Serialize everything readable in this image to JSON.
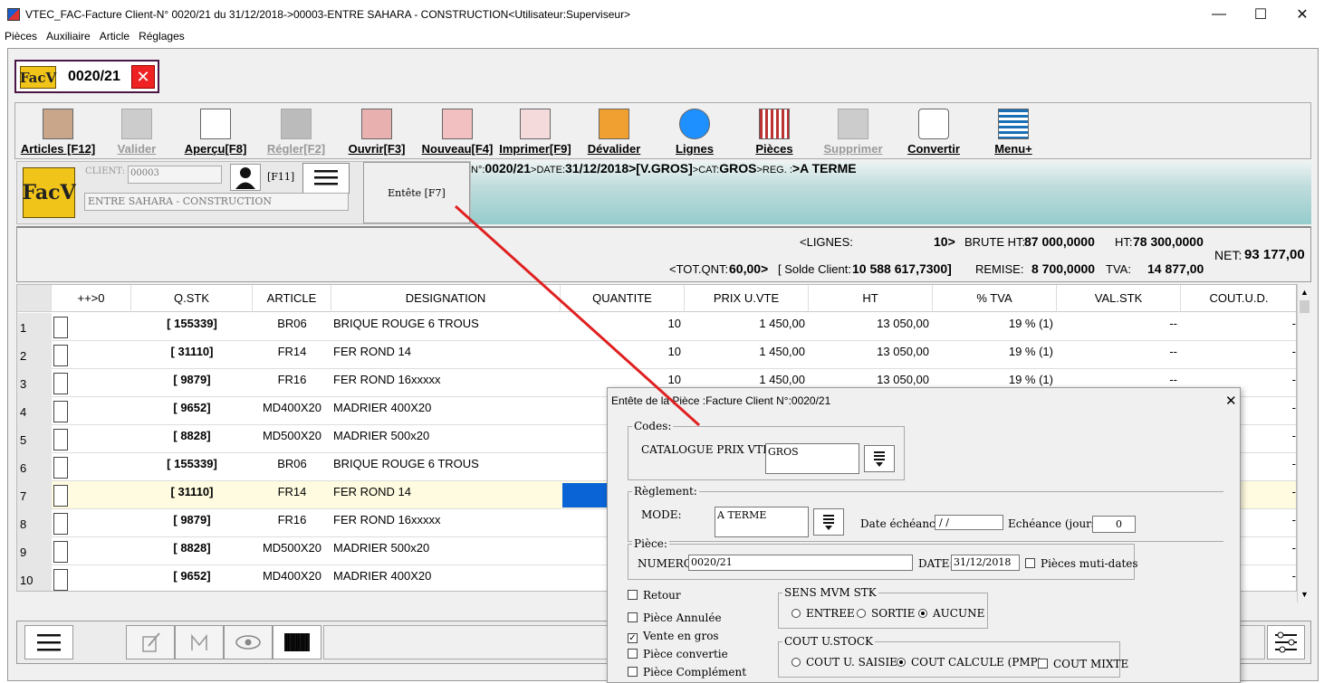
{
  "window": {
    "title": "VTEC_FAC-Facture Client-N° 0020/21 du 31/12/2018->00003-ENTRE SAHARA - CONSTRUCTION<Utilisateur:Superviseur>"
  },
  "menu": [
    "Pièces",
    "Auxiliaire",
    "Article",
    "Réglages"
  ],
  "doc_tab": {
    "badge": "FacV",
    "number": "0020/21"
  },
  "toolbar": [
    {
      "label": "Articles [F12]",
      "enabled": true,
      "icon": "articles-icon"
    },
    {
      "label": "Valider",
      "enabled": false,
      "icon": "validate-icon"
    },
    {
      "label": "Aperçu[F8]",
      "enabled": true,
      "icon": "preview-icon"
    },
    {
      "label": "Régler[F2]",
      "enabled": false,
      "icon": "payment-icon"
    },
    {
      "label": "Ouvrir[F3]",
      "enabled": true,
      "icon": "open-icon"
    },
    {
      "label": "Nouveau[F4]",
      "enabled": true,
      "icon": "new-icon"
    },
    {
      "label": "Imprimer[F9]",
      "enabled": true,
      "icon": "printer-icon"
    },
    {
      "label": "Dévalider",
      "enabled": true,
      "icon": "unvalidate-icon"
    },
    {
      "label": "Lignes",
      "enabled": true,
      "icon": "magnifier-icon"
    },
    {
      "label": "Pièces",
      "enabled": true,
      "icon": "pieces-grid-icon"
    },
    {
      "label": "Supprimer",
      "enabled": false,
      "icon": "trash-icon"
    },
    {
      "label": "Convertir",
      "enabled": true,
      "icon": "convert-icon"
    },
    {
      "label": "Menu+",
      "enabled": true,
      "icon": "menu-lines-icon"
    }
  ],
  "client": {
    "badge": "FacV",
    "label": "CLIENT:",
    "code": "00003",
    "f11": "[F11]",
    "name": "ENTRE SAHARA - CONSTRUCTION",
    "entete_button": "Entête [F7]"
  },
  "info": {
    "num_key": "N°:",
    "num": "0020/21",
    "date_key": ">DATE:",
    "date": "31/12/2018",
    "vente": ">[V.GROS]",
    "cat_key": ">CAT:",
    "cat": "GROS",
    "reg_key": ">REG.  :",
    "reg": ">A TERME"
  },
  "totals": {
    "lignes_label": "<LIGNES:",
    "lignes_value": "10>",
    "brute_label": "BRUTE HT:",
    "brute_value": "87 000,0000",
    "ht_label": "HT:",
    "ht_value": "78 300,0000",
    "net_label": "NET:",
    "net_value": "93 177,00",
    "totqnt_label": "<TOT.QNT:",
    "totqnt_value": "60,00>",
    "solde_label": "[ Solde Client:",
    "solde_value": "10 588 617,7300]",
    "remise_label": "REMISE:",
    "remise_value": "8 700,0000",
    "tva_label": "TVA:",
    "tva_value": "14 877,00"
  },
  "grid": {
    "columns": [
      "++>0",
      "Q.STK",
      "ARTICLE",
      "DESIGNATION",
      "QUANTITE",
      "PRIX U.VTE",
      "HT",
      "% TVA",
      "VAL.STK",
      "COUT.U.D."
    ],
    "rows": [
      {
        "n": "1",
        "qstk": "[ 155339]",
        "article": "BR06",
        "designation": "BRIQUE ROUGE 6 TROUS",
        "quantite": "10",
        "prix": "1 450,00",
        "ht": "13 050,00",
        "tva": "19 % (1)",
        "valstk": "--",
        "cout": "-"
      },
      {
        "n": "2",
        "qstk": "[ 31110]",
        "article": "FR14",
        "designation": "FER ROND 14",
        "quantite": "10",
        "prix": "1 450,00",
        "ht": "13 050,00",
        "tva": "19 % (1)",
        "valstk": "--",
        "cout": "-"
      },
      {
        "n": "3",
        "qstk": "[ 9879]",
        "article": "FR16",
        "designation": "FER ROND 16xxxxx",
        "quantite": "10",
        "prix": "1 450,00",
        "ht": "13 050,00",
        "tva": "19 % (1)",
        "valstk": "--",
        "cout": "-"
      },
      {
        "n": "4",
        "qstk": "[ 9652]",
        "article": "MD400X20",
        "designation": "MADRIER 400X20",
        "quantite": "",
        "prix": "",
        "ht": "",
        "tva": "",
        "valstk": "",
        "cout": "-"
      },
      {
        "n": "5",
        "qstk": "[ 8828]",
        "article": "MD500X20",
        "designation": "MADRIER 500x20",
        "quantite": "",
        "prix": "",
        "ht": "",
        "tva": "",
        "valstk": "",
        "cout": "-"
      },
      {
        "n": "6",
        "qstk": "[ 155339]",
        "article": "BR06",
        "designation": "BRIQUE ROUGE 6 TROUS",
        "quantite": "",
        "prix": "",
        "ht": "",
        "tva": "",
        "valstk": "",
        "cout": "-"
      },
      {
        "n": "7",
        "qstk": "[ 31110]",
        "article": "FR14",
        "designation": "FER ROND 14",
        "quantite": "",
        "prix": "",
        "ht": "",
        "tva": "",
        "valstk": "",
        "cout": "-"
      },
      {
        "n": "8",
        "qstk": "[ 9879]",
        "article": "FR16",
        "designation": "FER ROND 16xxxxx",
        "quantite": "",
        "prix": "",
        "ht": "",
        "tva": "",
        "valstk": "",
        "cout": "-"
      },
      {
        "n": "9",
        "qstk": "[ 8828]",
        "article": "MD500X20",
        "designation": "MADRIER 500x20",
        "quantite": "",
        "prix": "",
        "ht": "",
        "tva": "",
        "valstk": "",
        "cout": "-"
      },
      {
        "n": "10",
        "qstk": "[ 9652]",
        "article": "MD400X20",
        "designation": "MADRIER 400X20",
        "quantite": "",
        "prix": "",
        "ht": "",
        "tva": "",
        "valstk": "",
        "cout": "-"
      }
    ]
  },
  "dialog": {
    "title": "Entête de la Pièce :Facture Client N°:0020/21",
    "codes": {
      "legend": "Codes:",
      "catalogue_label": "CATALOGUE PRIX VTE:",
      "catalogue_value": "GROS"
    },
    "reglement": {
      "legend": "Règlement:",
      "mode_label": "MODE:",
      "mode_value": "A TERME",
      "date_echeance_label": "Date échéance:",
      "date_echeance_value": "/ /",
      "echeance_jours_label": "Echéance (jours):",
      "echeance_jours_value": "0"
    },
    "piece": {
      "legend": "Pièce:",
      "numero_label": "NUMERO:",
      "numero_value": "0020/21",
      "date_label": "DATE:",
      "date_value": "31/12/2018",
      "multi_dates_label": "Pièces muti-dates"
    },
    "checks": [
      {
        "label": "Retour",
        "checked": false
      },
      {
        "label": "Pièce Annulée",
        "checked": false
      },
      {
        "label": "Vente en gros",
        "checked": true
      },
      {
        "label": "Pièce convertie",
        "checked": false
      },
      {
        "label": "Pièce Complément",
        "checked": false
      }
    ],
    "sens": {
      "legend": "SENS MVM STK",
      "options": [
        "ENTREE",
        "SORTIE",
        "AUCUNE"
      ],
      "selected": "AUCUNE"
    },
    "cout": {
      "legend": "COUT U.STOCK",
      "options": [
        "COUT U. SAISIE",
        "COUT CALCULE (PMP)"
      ],
      "selected": "COUT CALCULE (PMP)",
      "mixte_label": "COUT MIXTE"
    }
  }
}
